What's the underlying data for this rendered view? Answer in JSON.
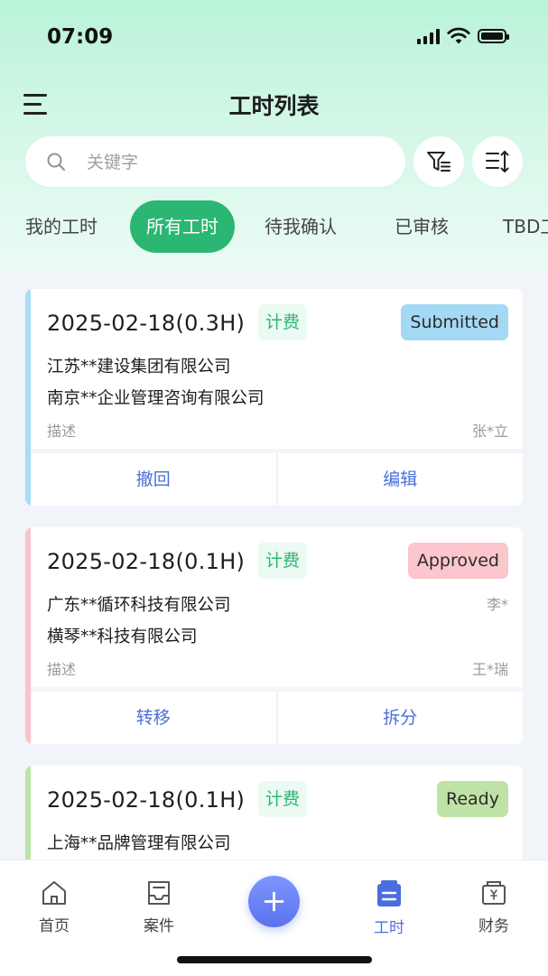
{
  "status_bar": {
    "time": "07:09"
  },
  "header": {
    "title": "工时列表"
  },
  "search": {
    "placeholder": "关键字"
  },
  "tabs": [
    {
      "label": "我的工时",
      "active": false
    },
    {
      "label": "所有工时",
      "active": true
    },
    {
      "label": "待我确认",
      "active": false
    },
    {
      "label": "已审核",
      "active": false
    },
    {
      "label": "TBD工",
      "active": false
    }
  ],
  "cards": [
    {
      "date": "2025-02-18(0.3H)",
      "tag": "计费",
      "status": "Submitted",
      "status_bg": "#a3d9f5",
      "bar_color": "#a8dcf7",
      "company1": "江苏**建设集团有限公司",
      "company2": "南京**企业管理咨询有限公司",
      "meta1": "",
      "description": "描述",
      "person": "张*立",
      "actions": [
        "撤回",
        "编辑"
      ]
    },
    {
      "date": "2025-02-18(0.1H)",
      "tag": "计费",
      "status": "Approved",
      "status_bg": "#fbc6cc",
      "bar_color": "#fbc4ca",
      "company1": "广东**循环科技有限公司",
      "company2": "横琴**科技有限公司",
      "meta1": "李*",
      "description": "描述",
      "person": "王*瑞",
      "actions": [
        "转移",
        "拆分"
      ]
    },
    {
      "date": "2025-02-18(0.1H)",
      "tag": "计费",
      "status": "Ready",
      "status_bg": "#bfe2a6",
      "bar_color": "#bde5a5",
      "company1": "上海**品牌管理有限公司"
    }
  ],
  "bottom_nav": {
    "items": [
      {
        "label": "首页",
        "icon": "home-icon"
      },
      {
        "label": "案件",
        "icon": "case-icon"
      },
      {
        "label": "工时",
        "icon": "timesheet-icon",
        "active": true
      },
      {
        "label": "财务",
        "icon": "finance-icon"
      }
    ],
    "fab_icon": "plus-icon"
  },
  "colors": {
    "accent_green": "#2bb673",
    "link_blue": "#4a6fd8",
    "nav_active": "#4a6ee0"
  }
}
